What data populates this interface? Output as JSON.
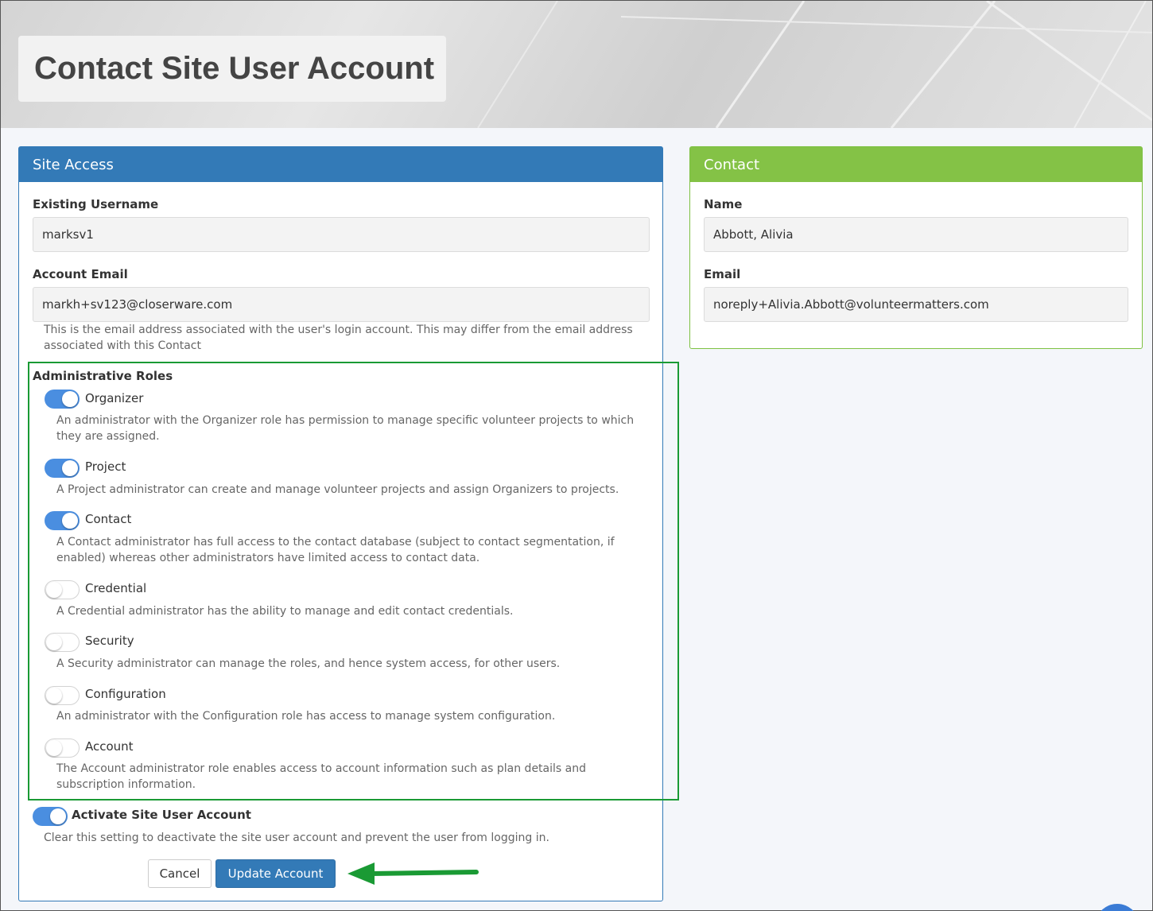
{
  "page": {
    "title": "Contact Site User Account"
  },
  "site_access": {
    "header": "Site Access",
    "username_label": "Existing Username",
    "username_value": "marksv1",
    "email_label": "Account Email",
    "email_value": "markh+sv123@closerware.com",
    "email_help_line1": "This is the email address associated with the user's login account. This may differ from the email address",
    "email_help_line2": "associated with this Contact",
    "roles_label": "Administrative Roles",
    "roles": [
      {
        "name": "Organizer",
        "on": true,
        "desc1": "An administrator with the Organizer role has permission to manage specific volunteer projects to which",
        "desc2": "they are assigned."
      },
      {
        "name": "Project",
        "on": true,
        "desc1": "A Project administrator can create and manage volunteer projects and assign Organizers to projects.",
        "desc2": ""
      },
      {
        "name": "Contact",
        "on": true,
        "desc1": "A Contact administrator has full access to the contact database (subject to contact segmentation, if",
        "desc2": "enabled) whereas other administrators have limited access to contact data."
      },
      {
        "name": "Credential",
        "on": false,
        "desc1": "A Credential administrator has the ability to manage and edit contact credentials.",
        "desc2": ""
      },
      {
        "name": "Security",
        "on": false,
        "desc1": "A Security administrator can manage the roles, and hence system access, for other users.",
        "desc2": ""
      },
      {
        "name": "Configuration",
        "on": false,
        "desc1": "An administrator with the Configuration role has access to manage system configuration.",
        "desc2": ""
      },
      {
        "name": "Account",
        "on": false,
        "desc1": "The Account administrator role enables access to account information such as plan details and",
        "desc2": "subscription information."
      }
    ],
    "activate_label": "Activate Site User Account",
    "activate_on": true,
    "activate_help": "Clear this setting to deactivate the site user account and prevent the user from logging in.",
    "cancel_label": "Cancel",
    "update_label": "Update Account"
  },
  "contact": {
    "header": "Contact",
    "name_label": "Name",
    "name_value": "Abbott, Alivia",
    "email_label": "Email",
    "email_value": "noreply+Alivia.Abbott@volunteermatters.com"
  },
  "colors": {
    "site_panel": "#337ab7",
    "contact_panel": "#84c246",
    "toggle_on": "#4a8ee0",
    "annotation": "#1a9a34"
  }
}
